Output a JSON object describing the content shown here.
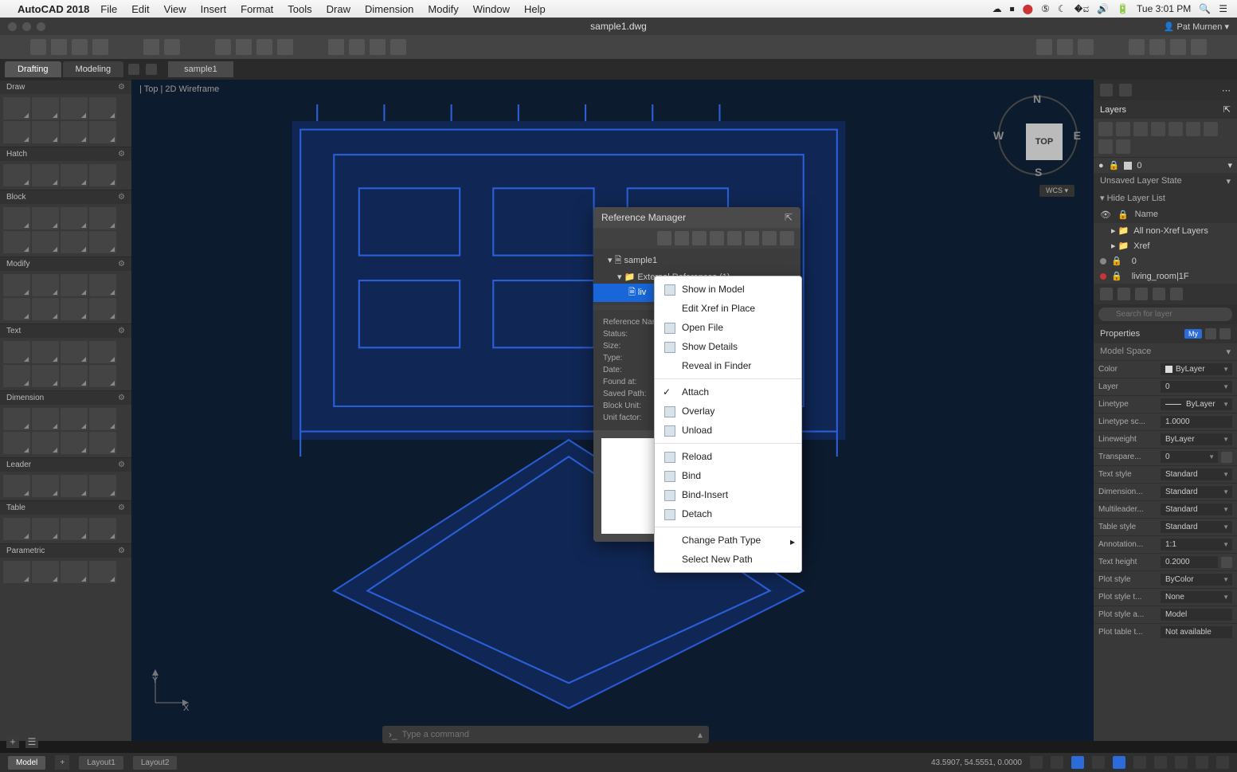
{
  "menubar": {
    "app": "AutoCAD 2018",
    "items": [
      "File",
      "Edit",
      "View",
      "Insert",
      "Format",
      "Tools",
      "Draw",
      "Dimension",
      "Modify",
      "Window",
      "Help"
    ],
    "clock": "Tue 3:01 PM"
  },
  "window": {
    "title": "sample1.dwg",
    "user": "Pat Murnen"
  },
  "tabs": {
    "workspace": [
      "Drafting",
      "Modeling"
    ],
    "active_workspace": "Drafting",
    "doc": "sample1"
  },
  "canvas": {
    "breadcrumb": "| Top | 2D Wireframe",
    "viewcube": {
      "face": "TOP",
      "n": "N",
      "e": "E",
      "s": "S",
      "w": "W"
    },
    "wcs": "WCS",
    "axis_y": "Y",
    "axis_x": "X"
  },
  "left_sections": [
    "Draw",
    "Hatch",
    "Block",
    "Modify",
    "Text",
    "Dimension",
    "Leader",
    "Table",
    "Parametric"
  ],
  "ref_manager": {
    "title": "Reference Manager",
    "tree": {
      "root": "sample1",
      "ext": "External References (1)",
      "item": "liv"
    },
    "labels": [
      "Reference Name:",
      "Status:",
      "Size:",
      "Type:",
      "Date:",
      "Found at:",
      "Saved Path:",
      "Block Unit:",
      "Unit factor:"
    ]
  },
  "context_menu": [
    {
      "label": "Show in Model",
      "icon": true
    },
    {
      "label": "Edit Xref in Place"
    },
    {
      "label": "Open File",
      "icon": true
    },
    {
      "label": "Show Details",
      "icon": true
    },
    {
      "label": "Reveal in Finder"
    },
    {
      "sep": true
    },
    {
      "label": "Attach",
      "check": true,
      "icon": true
    },
    {
      "label": "Overlay",
      "icon": true
    },
    {
      "label": "Unload",
      "icon": true
    },
    {
      "sep": true
    },
    {
      "label": "Reload",
      "icon": true
    },
    {
      "label": "Bind",
      "icon": true
    },
    {
      "label": "Bind-Insert",
      "icon": true
    },
    {
      "label": "Detach",
      "icon": true
    },
    {
      "sep": true
    },
    {
      "label": "Change Path Type",
      "sub": true
    },
    {
      "label": "Select New Path"
    }
  ],
  "right": {
    "layers_title": "Layers",
    "current_layer": "0",
    "layer_state": "Unsaved Layer State",
    "hide": "Hide Layer List",
    "name_hdr": "Name",
    "layers": [
      {
        "name": "All non-Xref Layers",
        "nest": 1
      },
      {
        "name": "Xref",
        "nest": 1
      },
      {
        "name": "0",
        "nest": 0,
        "on": true
      },
      {
        "name": "living_room|1F",
        "nest": 0,
        "on": true,
        "color": "b"
      }
    ],
    "search_ph": "Search for layer",
    "properties_title": "Properties",
    "my": "My",
    "space": "Model Space",
    "rows": [
      {
        "k": "Color",
        "v": "ByLayer",
        "sw": true,
        "dd": true
      },
      {
        "k": "Layer",
        "v": "0",
        "dd": true
      },
      {
        "k": "Linetype",
        "v": "ByLayer",
        "dd": true,
        "line": true
      },
      {
        "k": "Linetype sc...",
        "v": "1.0000"
      },
      {
        "k": "Lineweight",
        "v": "ByLayer",
        "dd": true
      },
      {
        "k": "Transpare...",
        "v": "0",
        "dd": true,
        "extra": true
      },
      {
        "k": "Text style",
        "v": "Standard",
        "dd": true
      },
      {
        "k": "Dimension...",
        "v": "Standard",
        "dd": true
      },
      {
        "k": "Multileader...",
        "v": "Standard",
        "dd": true
      },
      {
        "k": "Table style",
        "v": "Standard",
        "dd": true
      },
      {
        "k": "Annotation...",
        "v": "1:1",
        "dd": true
      },
      {
        "k": "Text height",
        "v": "0.2000",
        "extra": true
      },
      {
        "k": "Plot style",
        "v": "ByColor",
        "dd": true
      },
      {
        "k": "Plot style t...",
        "v": "None",
        "dd": true
      },
      {
        "k": "Plot style a...",
        "v": "Model"
      },
      {
        "k": "Plot table t...",
        "v": "Not available"
      }
    ]
  },
  "command": {
    "placeholder": "Type a command"
  },
  "status": {
    "tabs": [
      "Model",
      "Layout1",
      "Layout2"
    ],
    "coords": "43.5907, 54.5551, 0.0000"
  }
}
